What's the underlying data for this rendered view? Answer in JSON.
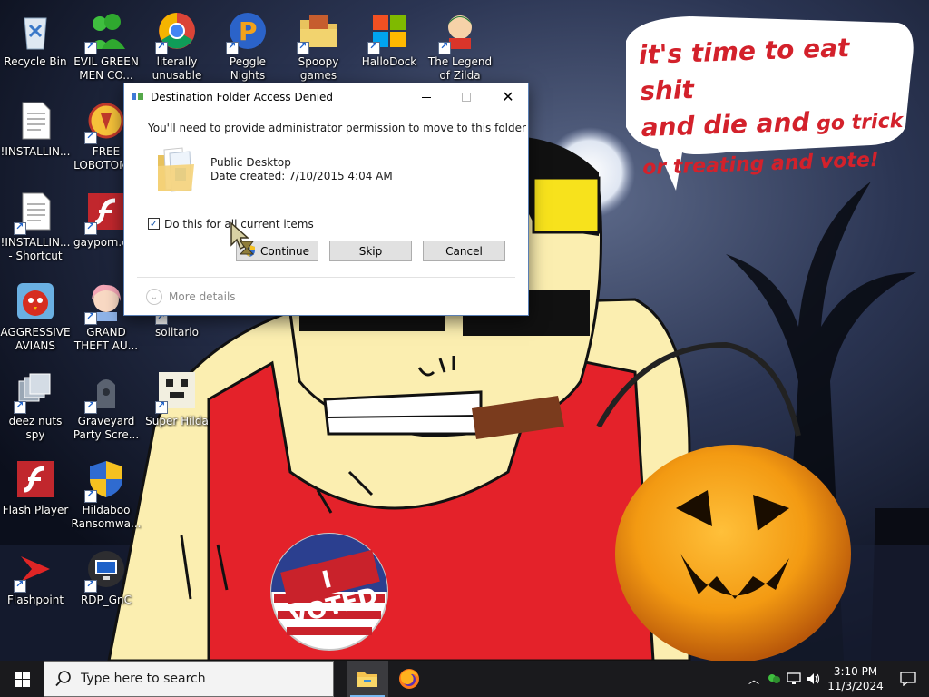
{
  "desktop": {
    "icons": [
      {
        "label": "Recycle Bin",
        "icon": "recycle-bin-icon"
      },
      {
        "label": "EVIL GREEN\nMEN CO...",
        "icon": "green-men-icon"
      },
      {
        "label": "literally\nunusable",
        "icon": "chrome-icon"
      },
      {
        "label": "Peggle Nights\nDeluxe",
        "icon": "peggle-icon"
      },
      {
        "label": "Spoopy\ngames",
        "icon": "folder-icon"
      },
      {
        "label": "HalloDock",
        "icon": "windows-logo-icon"
      },
      {
        "label": "The Legend\nof Zilda",
        "icon": "zilda-icon"
      },
      {
        "label": "!INSTALLIN...",
        "icon": "document-icon"
      },
      {
        "label": "FREE\nLOBOTOM...",
        "icon": "lobotomy-icon"
      },
      {
        "label": "!INSTALLIN...\n- Shortcut",
        "icon": "document-icon"
      },
      {
        "label": "gayporn.e...",
        "icon": "flash-icon"
      },
      {
        "label": "AGGRESSIVE\nAVIANS",
        "icon": "angry-bird-icon"
      },
      {
        "label": "GRAND\nTHEFT AU...",
        "icon": "anime-girl-icon"
      },
      {
        "label": "solitario",
        "icon": "solitaire-icon"
      },
      {
        "label": "deez nuts spy",
        "icon": "windows-stack-icon"
      },
      {
        "label": "Graveyard\nParty Scre...",
        "icon": "graveyard-icon"
      },
      {
        "label": "Super Hilda",
        "icon": "super-hilda-icon"
      },
      {
        "label": "Flash Player",
        "icon": "flash-icon"
      },
      {
        "label": "Hildaboo\nRansomwa...",
        "icon": "yashma-shield-icon"
      },
      {
        "label": "Flashpoint",
        "icon": "flashpoint-icon"
      },
      {
        "label": "RDP_GnC",
        "icon": "rdp-icon"
      }
    ]
  },
  "dialog": {
    "title": "Destination Folder Access Denied",
    "message": "You'll need to provide administrator permission to move to this folder",
    "folder_name": "Public Desktop",
    "folder_date": "Date created: 7/10/2015 4:04 AM",
    "checkbox_label": "Do this for all current items",
    "checkbox_checked": true,
    "buttons": {
      "continue": "Continue",
      "skip": "Skip",
      "cancel": "Cancel"
    },
    "more_details": "More details",
    "window_buttons": {
      "minimize": "minimize-icon",
      "maximize": "maximize-icon",
      "close": "✕"
    }
  },
  "wallpaper": {
    "bubble_line1": "it's time to eat shit",
    "bubble_line2a": "and die and",
    "bubble_line2b": " go trick",
    "bubble_line3": "or treating and vote!",
    "badge_text": "I VOTED"
  },
  "taskbar": {
    "search_placeholder": "Type here to search",
    "clock_time": "3:10 PM",
    "clock_date": "11/3/2024",
    "apps": [
      "file-explorer-icon",
      "firefox-icon"
    ]
  },
  "colors": {
    "accent": "#0078d7",
    "bubble_text": "#d3212b",
    "taskbar": "#1a1a1d"
  }
}
